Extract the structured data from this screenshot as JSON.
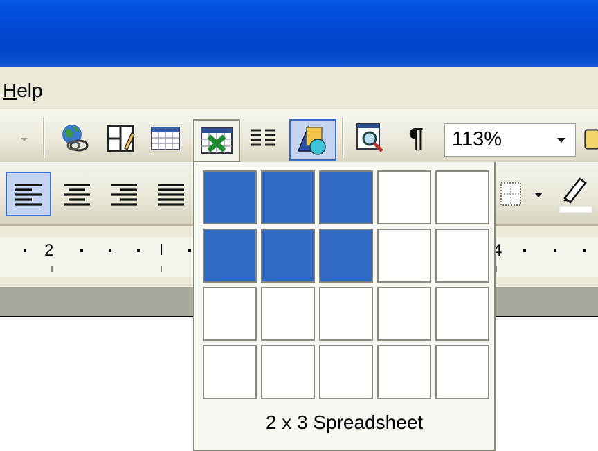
{
  "menu": {
    "help_label": "Help"
  },
  "toolbar": {
    "zoom_value": "113%",
    "buttons": [
      "dropdown-arrow",
      "web-icon",
      "draw-table-icon",
      "insert-table-icon",
      "insert-spreadsheet-icon",
      "columns-icon",
      "drawing-icon",
      "document-map-icon",
      "paragraph-mark-icon"
    ]
  },
  "format_toolbar": {
    "buttons": [
      "align-left-icon",
      "align-center-icon",
      "align-right-icon",
      "justify-icon",
      "border-icon",
      "highlight-icon"
    ]
  },
  "ruler": {
    "labels": [
      "2",
      "4"
    ]
  },
  "spreadsheet_popup": {
    "rows": 4,
    "cols": 5,
    "selected_rows": 2,
    "selected_cols": 3,
    "label": "2 x 3 Spreadsheet"
  },
  "colors": {
    "selected_cell": "#316ac5",
    "titlebar": "#0249d4",
    "chrome": "#ece9d8"
  }
}
